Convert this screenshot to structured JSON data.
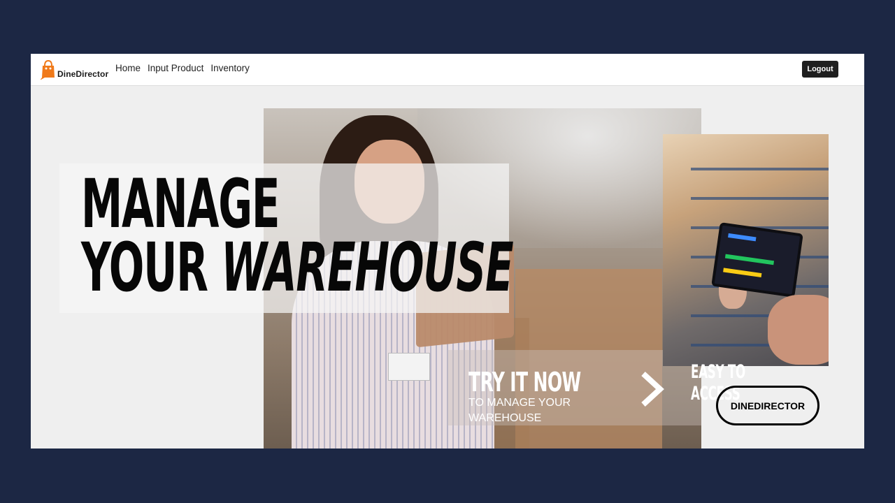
{
  "brand": {
    "name": "DineDirector",
    "icon": "shopping-bag-icon",
    "accent": "#f07a1a"
  },
  "nav": {
    "items": [
      "Home",
      "Input Product",
      "Inventory"
    ]
  },
  "header": {
    "logout_label": "Logout"
  },
  "hero": {
    "headline_line1": "MANAGE",
    "headline_line2_plain": "YOUR",
    "headline_line2_italic": "WAREHOUSE",
    "cta_title": "TRY IT NOW",
    "cta_subtitle": "TO MANAGE YOUR WAREHOUSE",
    "cta_icon": "chevron-right-icon",
    "side_caption": "EASY TO ACCESS",
    "brand_button": "DINEDIRECTOR"
  },
  "colors": {
    "background": "#1c2744",
    "page": "#efefef",
    "nav_bg": "#ffffff",
    "logout_bg": "#1f1f1f"
  }
}
